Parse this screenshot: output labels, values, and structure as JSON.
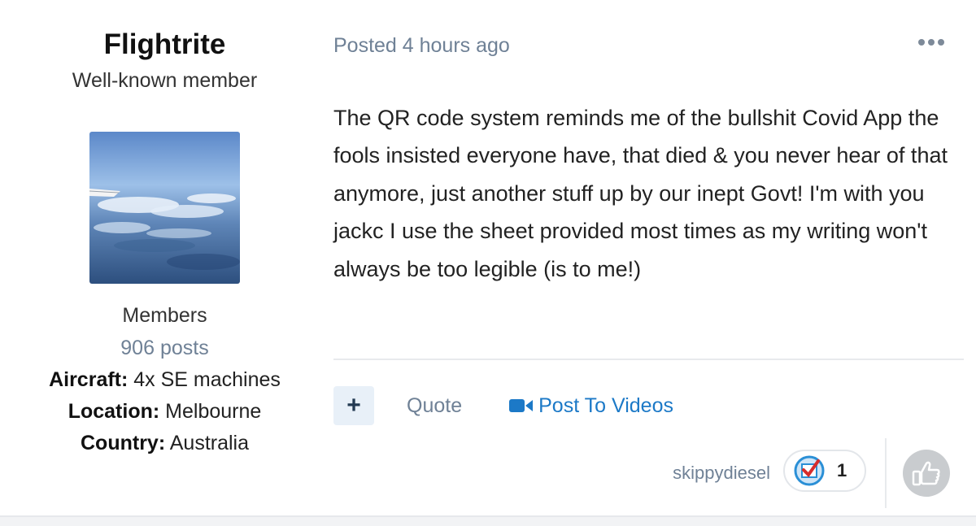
{
  "author": {
    "name": "Flightrite",
    "title": "Well-known member",
    "avatar": "avatar-photo-airplane-wing-over-clouds",
    "group": "Members",
    "posts": "906 posts",
    "fields": [
      {
        "label": "Aircraft:",
        "value": "4x SE machines"
      },
      {
        "label": "Location:",
        "value": "Melbourne"
      },
      {
        "label": "Country:",
        "value": "Australia"
      }
    ]
  },
  "post": {
    "posted": "Posted 4 hours ago",
    "more_icon": "ellipsis-icon",
    "body": "The QR code system reminds me of the bullshit Covid App the fools insisted everyone have, that died & you never hear of that anymore, just another stuff up by our inept Govt! I'm with you jackc I use the sheet provided most times as my writing won't always be too legible (is to me!)"
  },
  "actions": {
    "plus_label": "+",
    "quote_label": "Quote",
    "video_label": "Post To Videos",
    "video_icon": "video-camera-icon"
  },
  "reactions": {
    "reactor": "skippydiesel",
    "reaction_icon": "checkmark-reaction-icon",
    "count": "1",
    "like_icon": "thumbs-up-icon"
  },
  "colors": {
    "link": "#1c79c7",
    "muted": "#6f8196",
    "text": "#222222",
    "button_bg": "#e8f0f8"
  }
}
